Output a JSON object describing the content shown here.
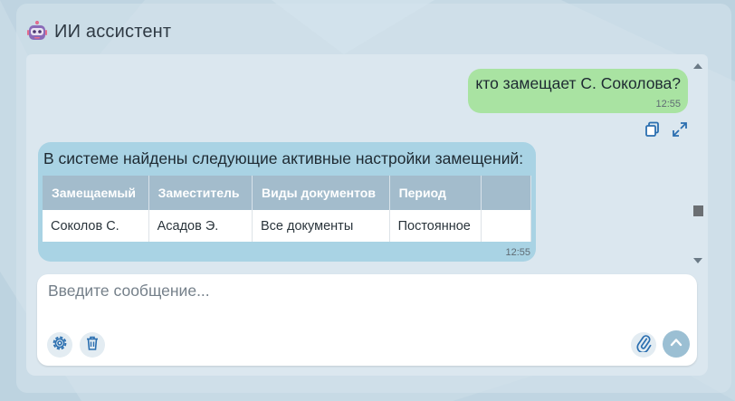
{
  "header": {
    "title": "ИИ ассистент",
    "icon": "robot-icon"
  },
  "chat": {
    "user_message": {
      "text": "кто замещает С. Соколова?",
      "time": "12:55",
      "color": "#a9e3a2"
    },
    "assistant_message": {
      "intro": "В системе найдены следующие активные настройки замещений:",
      "time": "12:55",
      "color": "#a9d3e4",
      "table": {
        "headers": [
          "Замещаемый",
          "Заместитель",
          "Виды документов",
          "Период",
          ""
        ],
        "rows": [
          [
            "Соколов С.",
            "Асадов Э.",
            "Все документы",
            "Постоянное",
            ""
          ]
        ]
      }
    },
    "actions": [
      "copy-icon",
      "expand-icon"
    ]
  },
  "composer": {
    "placeholder": "Введите сообщение...",
    "buttons": [
      "settings-icon",
      "trash-icon",
      "paperclip-icon",
      "send-icon"
    ],
    "accent": "#9bbfd3"
  }
}
